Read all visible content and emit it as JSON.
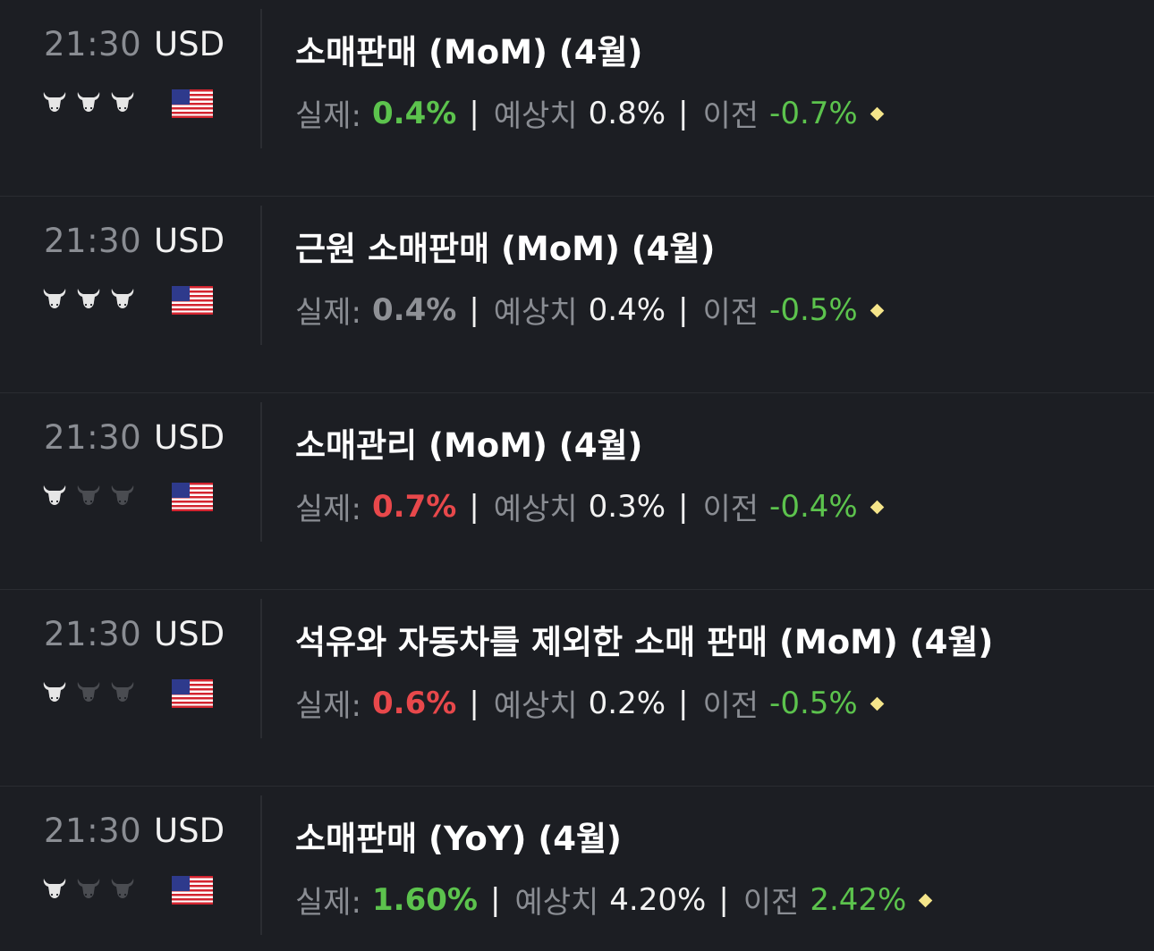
{
  "events": [
    {
      "time": "21:30",
      "currency": "USD",
      "importance": 3,
      "country": "us-flag",
      "title": "소매판매 (MoM) (4월)",
      "actual_label": "실제:",
      "actual": "0.4%",
      "actual_color": "#5cc34d",
      "forecast_label": "예상치",
      "forecast": "0.8%",
      "previous_label": "이전",
      "previous": "-0.7%",
      "previous_color": "#5cc34d",
      "separator": "|"
    },
    {
      "time": "21:30",
      "currency": "USD",
      "importance": 3,
      "country": "us-flag",
      "title": "근원 소매판매 (MoM) (4월)",
      "actual_label": "실제:",
      "actual": "0.4%",
      "actual_color": "#8f9196",
      "forecast_label": "예상치",
      "forecast": "0.4%",
      "previous_label": "이전",
      "previous": "-0.5%",
      "previous_color": "#5cc34d",
      "separator": "|"
    },
    {
      "time": "21:30",
      "currency": "USD",
      "importance": 1,
      "country": "us-flag",
      "title": "소매관리 (MoM) (4월)",
      "actual_label": "실제:",
      "actual": "0.7%",
      "actual_color": "#e8484b",
      "forecast_label": "예상치",
      "forecast": "0.3%",
      "previous_label": "이전",
      "previous": "-0.4%",
      "previous_color": "#5cc34d",
      "separator": "|"
    },
    {
      "time": "21:30",
      "currency": "USD",
      "importance": 1,
      "country": "us-flag",
      "title": "석유와 자동차를 제외한 소매 판매 (MoM) (4월)",
      "actual_label": "실제:",
      "actual": "0.6%",
      "actual_color": "#e8484b",
      "forecast_label": "예상치",
      "forecast": "0.2%",
      "previous_label": "이전",
      "previous": "-0.5%",
      "previous_color": "#5cc34d",
      "separator": "|"
    },
    {
      "time": "21:30",
      "currency": "USD",
      "importance": 1,
      "country": "us-flag",
      "title": "소매판매 (YoY) (4월)",
      "actual_label": "실제:",
      "actual": "1.60%",
      "actual_color": "#5cc34d",
      "forecast_label": "예상치",
      "forecast": "4.20%",
      "previous_label": "이전",
      "previous": "2.42%",
      "previous_color": "#5cc34d",
      "separator": "|"
    }
  ],
  "icons": {
    "importance": "bull-icon",
    "revision_marker": "diamond-icon"
  },
  "colors": {
    "background": "#1c1e23",
    "bull_active": "#e6e6e6",
    "bull_inactive": "#4a4c51",
    "revision_diamond": "#f5e58a"
  }
}
